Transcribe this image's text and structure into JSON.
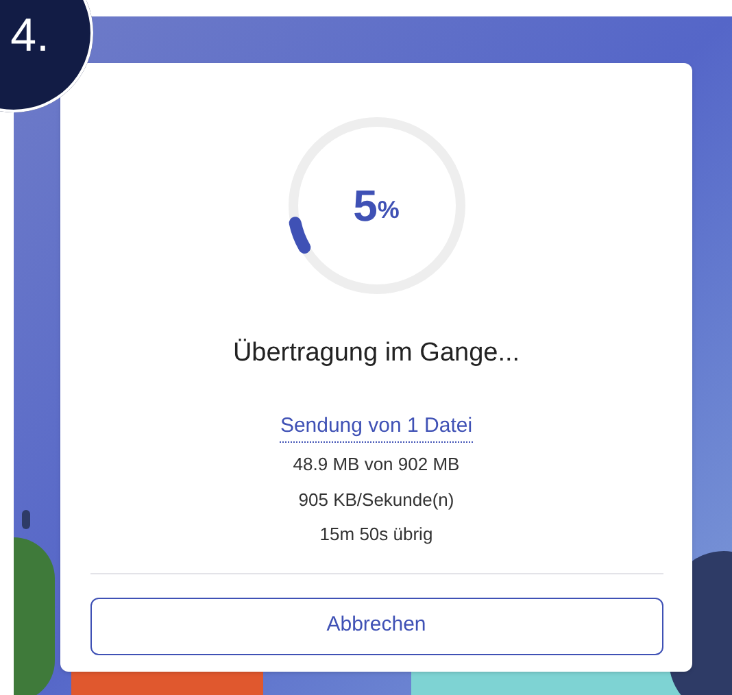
{
  "step_badge": "4.",
  "progress": {
    "level": 0.05,
    "value": "5",
    "unit": "%"
  },
  "title": "Übertragung im Gange...",
  "link": "Sendung von 1 Datei",
  "details": [
    "48.9 MB von 902 MB",
    "905 KB/Sekunde(n)",
    "15m 50s übrig"
  ],
  "button": "Abbrechen"
}
